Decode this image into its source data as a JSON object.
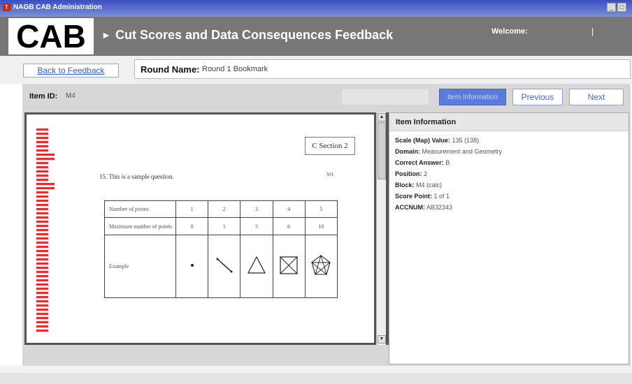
{
  "window": {
    "title": "NAGB CAB Administration",
    "controls": [
      "_",
      "□"
    ]
  },
  "header": {
    "logo": "CAB",
    "arrow": "►",
    "title": "Cut Scores and Data Consequences Feedback",
    "welcome_label": "Welcome:",
    "separator": "|"
  },
  "subbar": {
    "back_label": "Back to Feedback",
    "round_label": "Round Name:",
    "round_value": "Round 1 Bookmark"
  },
  "itembar": {
    "item_label": "Item ID:",
    "item_value": "M4",
    "item_info_label": "Item Information",
    "previous_label": "Previous",
    "next_label": "Next"
  },
  "document": {
    "section_label": "C",
    "section_text": "Section 2",
    "question_text": "15. This is a sample question.",
    "question_id": "M4",
    "table": {
      "row1_label": "Number of points",
      "row1_values": [
        "1",
        "2",
        "3",
        "4",
        "5"
      ],
      "row2_label": "Maximum number of points",
      "row2_values": [
        "0",
        "1",
        "3",
        "6",
        "10"
      ],
      "row3_label": "Example"
    }
  },
  "scrollbar": {
    "up": "▲",
    "down": "▼"
  },
  "info_panel": {
    "title": "Item Information",
    "rows": [
      {
        "k": "Scale (Map) Value:",
        "v": "135 (138)"
      },
      {
        "k": "Domain:",
        "v": "Measurement and Geometry"
      },
      {
        "k": "Correct Answer:",
        "v": "B"
      },
      {
        "k": "Position:",
        "v": "2"
      },
      {
        "k": "Block:",
        "v": "M4 (calc)"
      },
      {
        "k": "Score Point:",
        "v": "1 of 1"
      },
      {
        "k": "ACCNUM:",
        "v": "AB32343"
      }
    ]
  },
  "colors": {
    "header_bg": "#777777",
    "title_bar": "#3a4fbf",
    "accent_blue": "#5a7bd8",
    "bookmark_red": "#e23030"
  }
}
